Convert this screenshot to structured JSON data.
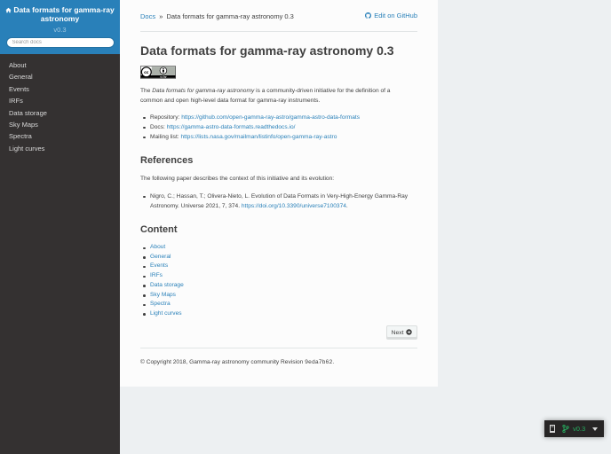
{
  "sidebar": {
    "project_name": "Data formats for gamma-ray astronomy",
    "version": "v0.3",
    "search_placeholder": "Search docs",
    "items": [
      {
        "label": "About"
      },
      {
        "label": "General"
      },
      {
        "label": "Events"
      },
      {
        "label": "IRFs"
      },
      {
        "label": "Data storage"
      },
      {
        "label": "Sky Maps"
      },
      {
        "label": "Spectra"
      },
      {
        "label": "Light curves"
      }
    ]
  },
  "breadcrumb": {
    "docs": "Docs",
    "separator": "»",
    "current": "Data formats for gamma-ray astronomy 0.3",
    "edit_link": "Edit on GitHub"
  },
  "page": {
    "title": "Data formats for gamma-ray astronomy 0.3",
    "license_badge": "cc by",
    "intro_prefix": "The ",
    "intro_em": "Data formats for gamma-ray astronomy",
    "intro_suffix": " is a community-driven initiative for the definition of a common and open high-level data format for gamma-ray instruments.",
    "links": [
      {
        "label": "Repository: ",
        "url": "https://github.com/open-gamma-ray-astro/gamma-astro-data-formats"
      },
      {
        "label": "Docs: ",
        "url": "https://gamma-astro-data-formats.readthedocs.io/"
      },
      {
        "label": "Mailing list: ",
        "url": "https://lists.nasa.gov/mailman/listinfo/open-gamma-ray-astro"
      }
    ],
    "references_heading": "References",
    "references_intro": "The following paper describes the context of this initiative and its evolution:",
    "reference_text": "Nigro, C.; Hassan, T.; Olivera-Nieto, L. Evolution of Data Formats in Very-High-Energy Gamma-Ray Astronomy. Universe 2021, 7, 374. ",
    "reference_doi": "https://doi.org/10.3390/universe7100374",
    "reference_end": ".",
    "content_heading": "Content",
    "content_items": [
      {
        "label": "About"
      },
      {
        "label": "General"
      },
      {
        "label": "Events"
      },
      {
        "label": "IRFs"
      },
      {
        "label": "Data storage"
      },
      {
        "label": "Sky Maps"
      },
      {
        "label": "Spectra"
      },
      {
        "label": "Light curves"
      }
    ],
    "next_label": "Next"
  },
  "footer": {
    "copyright": "© Copyright 2018, Gamma-ray astronomy community",
    "revision_label": " Revision ",
    "revision": "9eda7b62",
    "revision_end": "."
  },
  "version_badge": {
    "version": "v0.3"
  },
  "colors": {
    "accent": "#2980b9",
    "sidebar_bg": "#343131",
    "version_green": "#27ae60"
  }
}
